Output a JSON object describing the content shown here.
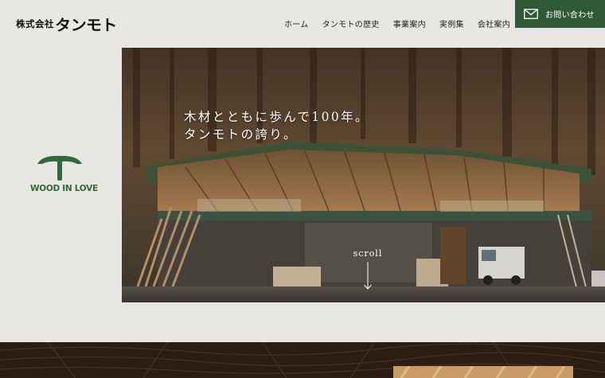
{
  "brand": {
    "prefix": "株式会社",
    "name": "タンモト"
  },
  "nav": {
    "items": [
      {
        "label": "ホーム"
      },
      {
        "label": "タンモトの歴史"
      },
      {
        "label": "事業案内"
      },
      {
        "label": "実例集"
      },
      {
        "label": "会社案内"
      }
    ]
  },
  "contact": {
    "label": "お問い合わせ",
    "icon": "mail-icon"
  },
  "emblem": {
    "icon": "tree-t-icon",
    "text": "WOOD IN LOVE",
    "color": "#2f6b3a"
  },
  "hero": {
    "line1": "木材とともに歩んで100年。",
    "line2": "タンモトの誇り。",
    "scroll_label": "scroll"
  },
  "colors": {
    "accent": "#2f5a36",
    "background": "#e8e7e4"
  }
}
